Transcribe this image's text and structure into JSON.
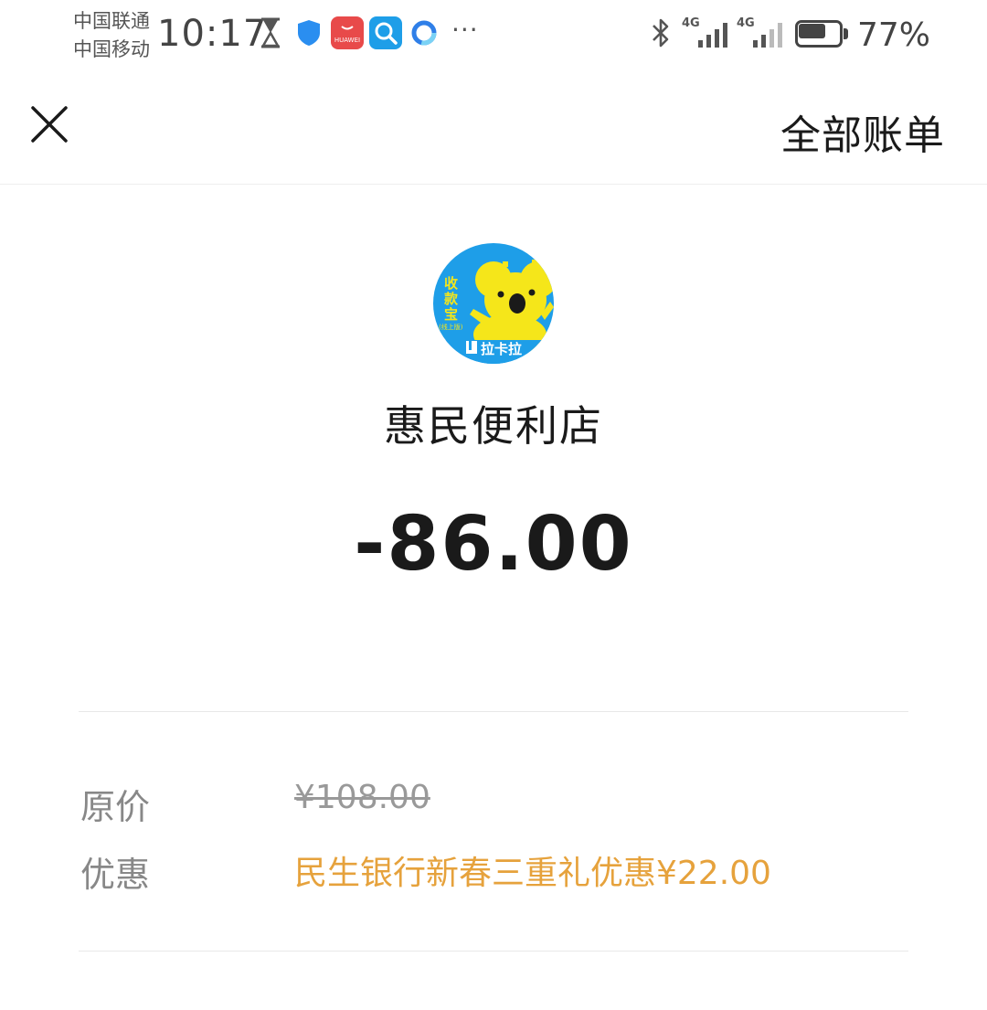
{
  "status_bar": {
    "carrier_1": "中国联通",
    "carrier_2": "中国移动",
    "time": "10:17",
    "app_icons": [
      "hourglass-icon",
      "shield-app-icon",
      "huawei-appgallery-icon",
      "search-app-icon",
      "browser-app-icon"
    ],
    "huawei_label": "HUAWEI",
    "more": "···",
    "signal_1_label": "4G",
    "signal_2_label": "4G",
    "battery_level": 0.77,
    "battery_text": "77%"
  },
  "nav": {
    "close_icon": "close-icon",
    "all_bills": "全部账单"
  },
  "merchant": {
    "logo_texts": [
      "收",
      "款",
      "宝",
      "(线上版)"
    ],
    "logo_brand": "拉卡拉",
    "name": "惠民便利店",
    "amount": "-86.00"
  },
  "details": {
    "original_price_label": "原价",
    "original_price": "¥108.00",
    "discount_label": "优惠",
    "discount_text": "民生银行新春三重礼优惠¥22.00"
  },
  "colors": {
    "discount": "#e6a23c",
    "logo_bg": "#1e9ee8",
    "logo_koala": "#f5e61a"
  }
}
